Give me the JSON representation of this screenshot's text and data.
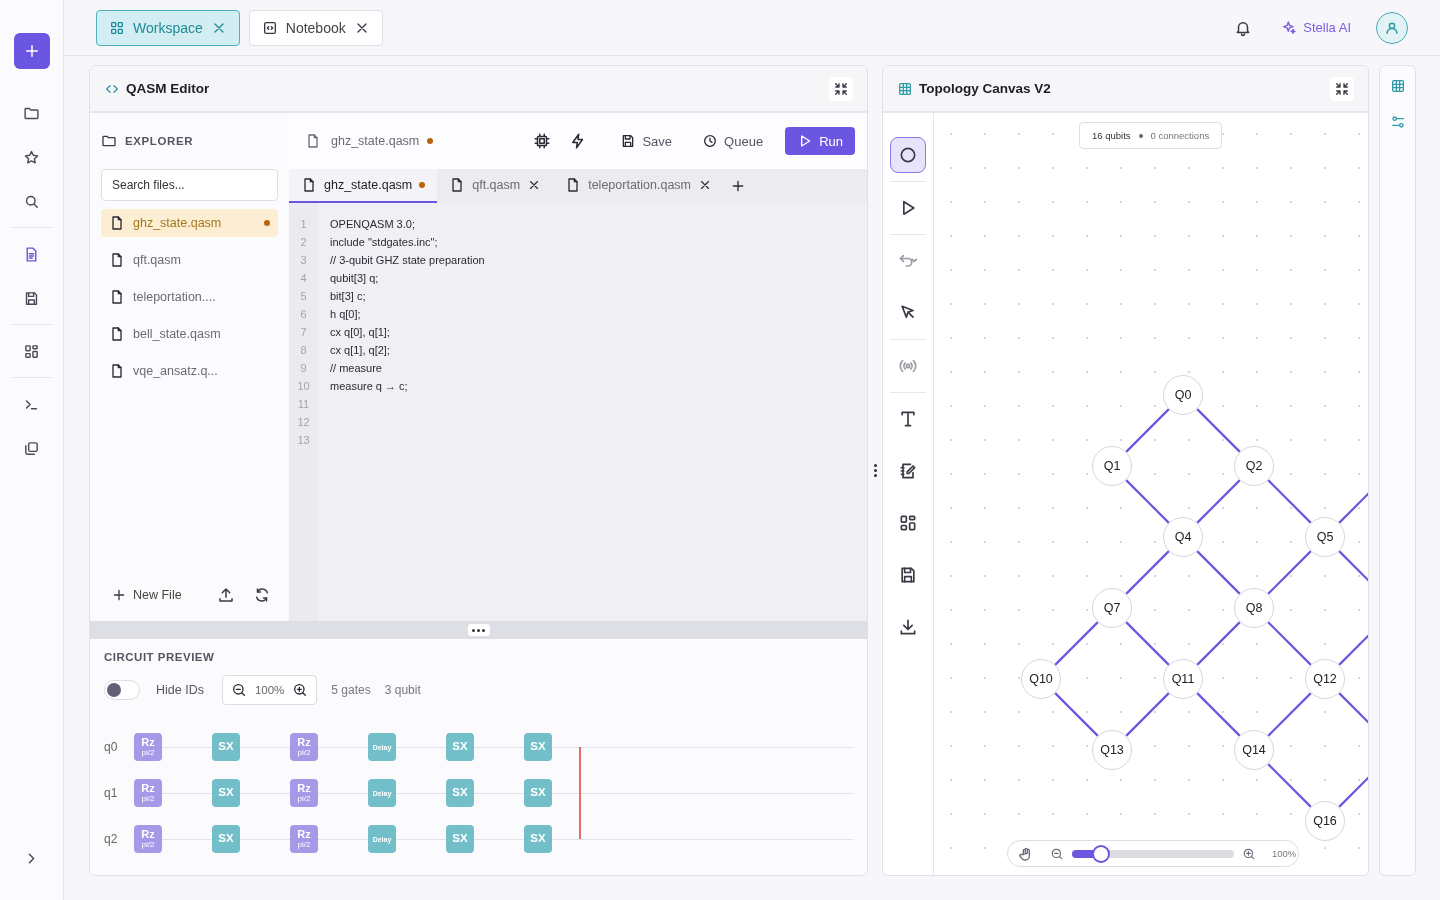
{
  "top_tabs": [
    {
      "label": "Workspace",
      "selected": true
    },
    {
      "label": "Notebook",
      "selected": false
    }
  ],
  "header": {
    "assistant": "Stella AI"
  },
  "rail": {
    "items": [
      {
        "selected": false
      },
      {
        "selected": false
      },
      {
        "selected": false
      },
      {
        "selected": true
      },
      {
        "selected": false
      },
      {
        "selected": false
      },
      {
        "selected": false
      },
      {
        "selected": false
      }
    ]
  },
  "editor": {
    "title": "QASM Editor",
    "explorer": {
      "title": "EXPLORER",
      "search": {
        "placeholder": "Search files..."
      },
      "files": [
        {
          "name": "ghz_state.qasm",
          "selected": true,
          "modified": true
        },
        {
          "name": "qft.qasm",
          "selected": false,
          "modified": false
        },
        {
          "name": "teleportation....",
          "selected": false,
          "modified": false
        },
        {
          "name": "bell_state.qasm",
          "selected": false,
          "modified": false
        },
        {
          "name": "vqe_ansatz.q...",
          "selected": false,
          "modified": false
        }
      ],
      "new_file": "New File"
    },
    "breadcrumb": {
      "file": "ghz_state.qasm",
      "modified": true
    },
    "toolbar": {
      "save": "Save",
      "queue": "Queue",
      "run": "Run"
    },
    "tabs": [
      {
        "label": "ghz_state.qasm",
        "selected": true,
        "modified": true
      },
      {
        "label": "qft.qasm",
        "selected": false,
        "modified": false
      },
      {
        "label": "teleportation.qasm",
        "selected": false,
        "modified": false
      }
    ],
    "lines": [
      {
        "number": "1",
        "code": "OPENQASM 3.0;"
      },
      {
        "number": "2",
        "code": "include \"stdgates.inc\";"
      },
      {
        "number": "3",
        "code": "// 3-qubit GHZ state preparation"
      },
      {
        "number": "4",
        "code": "qubit[3] q;"
      },
      {
        "number": "5",
        "code": "bit[3] c;"
      },
      {
        "number": "6",
        "code": "h q[0];"
      },
      {
        "number": "7",
        "code": "cx q[0], q[1];"
      },
      {
        "number": "8",
        "code": "cx q[1], q[2];"
      },
      {
        "number": "9",
        "code": "// measure"
      },
      {
        "number": "10",
        "code": "measure q → c;"
      },
      {
        "number": "11"
      },
      {
        "number": "12"
      },
      {
        "number": "13"
      }
    ]
  },
  "circuit": {
    "title": "CIRCUIT PREVIEW",
    "hide_ids": {
      "label": "Hide IDs",
      "on": false
    },
    "zoom": "100%",
    "gate_count": "5 gates",
    "qubit_count": "3 qubit",
    "wires": [
      {
        "label": "q0",
        "gates": [
          {
            "kind": "rz",
            "label": "Rz",
            "param": "pi/2"
          },
          {
            "kind": "sx",
            "label": "SX"
          },
          {
            "kind": "rz",
            "label": "Rz",
            "param": "pi/2"
          },
          {
            "kind": "delay",
            "label": "Delay"
          },
          {
            "kind": "sx",
            "label": "SX"
          },
          {
            "kind": "sx",
            "label": "SX"
          }
        ]
      },
      {
        "label": "q1",
        "gates": [
          {
            "kind": "rz",
            "label": "Rz",
            "param": "pi/2"
          },
          {
            "kind": "sx",
            "label": "SX"
          },
          {
            "kind": "rz",
            "label": "Rz",
            "param": "pi/2"
          },
          {
            "kind": "delay",
            "label": "Delay"
          },
          {
            "kind": "sx",
            "label": "SX"
          },
          {
            "kind": "sx",
            "label": "SX"
          }
        ]
      },
      {
        "label": "q2",
        "gates": [
          {
            "kind": "rz",
            "label": "Rz",
            "param": "pi/2"
          },
          {
            "kind": "sx",
            "label": "SX"
          },
          {
            "kind": "rz",
            "label": "Rz",
            "param": "pi/2"
          },
          {
            "kind": "delay",
            "label": "Delay"
          },
          {
            "kind": "sx",
            "label": "SX"
          },
          {
            "kind": "sx",
            "label": "SX"
          }
        ]
      }
    ]
  },
  "topology": {
    "title": "Topology Canvas V2",
    "qubit_count": "16 qubits",
    "connection_count": "0 connections",
    "tools": [
      {
        "selected": true,
        "disabled": false
      },
      {
        "selected": false,
        "disabled": false
      },
      {
        "selected": false,
        "disabled": true
      },
      {
        "selected": false,
        "disabled": false
      },
      {
        "selected": false,
        "disabled": true
      },
      {
        "selected": false,
        "disabled": false
      },
      {
        "selected": false,
        "disabled": false
      },
      {
        "selected": false,
        "disabled": false
      },
      {
        "selected": false,
        "disabled": false
      },
      {
        "selected": false,
        "disabled": false
      }
    ],
    "nodes": [
      {
        "label": "Q0"
      },
      {
        "label": "Q1"
      },
      {
        "label": "Q2"
      },
      {
        "label": "Q4"
      },
      {
        "label": "Q5"
      },
      {
        "label": "Q7"
      },
      {
        "label": "Q8"
      },
      {
        "label": "Q10"
      },
      {
        "label": "Q11"
      },
      {
        "label": "Q12"
      },
      {
        "label": "Q13"
      },
      {
        "label": "Q14"
      },
      {
        "label": "Q16"
      }
    ],
    "zoom": {
      "level": 0.18,
      "reading": "100%"
    }
  }
}
